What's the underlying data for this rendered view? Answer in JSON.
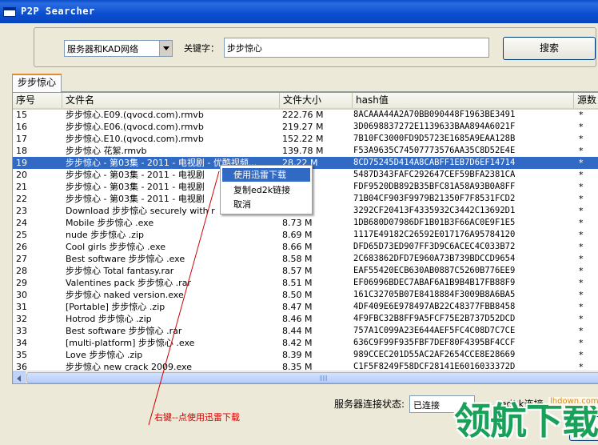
{
  "window": {
    "title": "P2P Searcher"
  },
  "search": {
    "network_value": "服务器和KAD网络",
    "keyword_label": "关键字：",
    "keyword_value": "步步惊心",
    "button_label": "搜索"
  },
  "tab": {
    "label": "步步惊心"
  },
  "table": {
    "columns": [
      "序号",
      "文件名",
      "文件大小",
      "hash值",
      "源数"
    ],
    "rows": [
      {
        "no": "15",
        "name": "步步惊心.E09.(qvocd.com).rmvb",
        "size": "222.76 M",
        "hash": "8ACAAA44A2A70BB090448F1963BE3491",
        "src": "*"
      },
      {
        "no": "16",
        "name": "步步惊心.E06.(qvocd.com).rmvb",
        "size": "219.27 M",
        "hash": "3D0698837272E1139633BAA894A6021F",
        "src": "*"
      },
      {
        "no": "17",
        "name": "步步惊心.E10.(qvocd.com).rmvb",
        "size": "152.22 M",
        "hash": "7B10FC3000FD9D5723E1685A9EAA128B",
        "src": "*"
      },
      {
        "no": "18",
        "name": "步步惊心 花絮.rmvb",
        "size": "139.78 M",
        "hash": "F53A9635C74507773576AA35C8D52E4E",
        "src": "*"
      },
      {
        "no": "19",
        "name": "步步惊心 - 第03集 - 2011 - 电视剧 - 优酷视频...",
        "size": "28.22 M",
        "hash": "8CD75245D414A8CABFF1EB7D6EF14714",
        "src": "*"
      },
      {
        "no": "20",
        "name": "步步惊心 - 第03集 - 2011 - 电视剧",
        "size": "",
        "hash": "5487D343FAFC292647CEF59BFA2381CA",
        "src": "*"
      },
      {
        "no": "21",
        "name": "步步惊心 - 第03集 - 2011 - 电视剧",
        "size": "",
        "hash": "FDF9520DB892B35BFC81A58A93B0A8FF",
        "src": "*"
      },
      {
        "no": "22",
        "name": "步步惊心 - 第03集 - 2011 - 电视剧",
        "size": "",
        "hash": "71B04CF903F9979B21350F7F8531FCD2",
        "src": "*"
      },
      {
        "no": "23",
        "name": "Download 步步惊心 securely with r",
        "size": "",
        "hash": "3292CF20413F4335932C3442C13692D1",
        "src": "*"
      },
      {
        "no": "24",
        "name": "Mobile 步步惊心 .exe",
        "size": "8.73 M",
        "hash": "1DB680D07986DF1B01B3F66AC0E9F1E5",
        "src": "*"
      },
      {
        "no": "25",
        "name": "nude 步步惊心 .zip",
        "size": "8.69 M",
        "hash": "1117E49182C26592E017176A95784120",
        "src": "*"
      },
      {
        "no": "26",
        "name": "Cool girls 步步惊心 .exe",
        "size": "8.66 M",
        "hash": "DFD65D73ED907FF3D9C6ACEC4C033B72",
        "src": "*"
      },
      {
        "no": "27",
        "name": "Best software 步步惊心 .exe",
        "size": "8.58 M",
        "hash": "2C683862DFD7E960A73B739BDCCD9654",
        "src": "*"
      },
      {
        "no": "28",
        "name": "步步惊心  Total fantasy.rar",
        "size": "8.57 M",
        "hash": "EAF55420ECB630AB0887C5260B776EE9",
        "src": "*"
      },
      {
        "no": "29",
        "name": "Valentines pack 步步惊心 .rar",
        "size": "8.51 M",
        "hash": "EF06996BDEC7ABAF6A1B9B4B17FB88F9",
        "src": "*"
      },
      {
        "no": "30",
        "name": "步步惊心  naked version.exe",
        "size": "8.50 M",
        "hash": "161C32705B07E8418884F3009B8A6BA5",
        "src": "*"
      },
      {
        "no": "31",
        "name": "[Portable] 步步惊心 .zip",
        "size": "8.47 M",
        "hash": "4DF409E6E978497AB22C48377FBB8458",
        "src": "*"
      },
      {
        "no": "32",
        "name": "Hotrod 步步惊心 .zip",
        "size": "8.46 M",
        "hash": "4F9FBC32B8FF9A5FCF75E2B737D52DCD",
        "src": "*"
      },
      {
        "no": "33",
        "name": "Best software 步步惊心 .rar",
        "size": "8.44 M",
        "hash": "757A1C099A23E644AEF5FC4C08D7C7CE",
        "src": "*"
      },
      {
        "no": "34",
        "name": "[multi-platform] 步步惊心 .exe",
        "size": "8.42 M",
        "hash": "636C9F99F935FBF7DEF80F4395BF4CCF",
        "src": "*"
      },
      {
        "no": "35",
        "name": "Love 步步惊心 .zip",
        "size": "8.39 M",
        "hash": "989CCEC201D55AC2AF2654CCE8E28669",
        "src": "*"
      },
      {
        "no": "36",
        "name": "步步惊心  new crack 2009.exe",
        "size": "8.35 M",
        "hash": "C1F5F8249F58DCF28141E6016033372D",
        "src": "*"
      }
    ],
    "selected_index": 4
  },
  "context_menu": {
    "items": [
      "使用迅雷下载",
      "复制ed2k链接",
      "取消"
    ],
    "highlighted_index": 0
  },
  "annotation": {
    "text": "右键--点使用迅雷下载",
    "color": "#d00000"
  },
  "status": {
    "server_label": "服务器连接状态:",
    "server_value": "已连接",
    "ed2k_label": "ed2k连接",
    "small_button_label": "连接"
  },
  "watermark": {
    "text": "领航下载",
    "url": "lhdown.com"
  },
  "colors": {
    "selection": "#316ac5",
    "titlebar": "#0b4fd0"
  }
}
